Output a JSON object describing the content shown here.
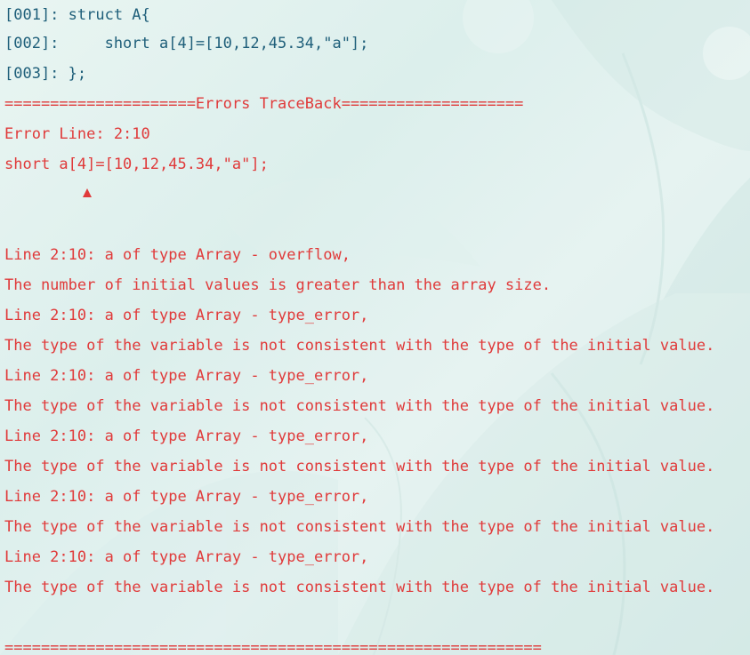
{
  "colors": {
    "code_text": "#1f5f7a",
    "error_text": "#e03a3a"
  },
  "source": {
    "lines": [
      "[001]: struct A{",
      "[002]:     short a[4]=[10,12,45.34,\"a\"];",
      "[003]: };"
    ]
  },
  "traceback": {
    "header": "=====================Errors TraceBack====================",
    "error_line_label": "Error Line: 2:10",
    "error_source": "short a[4]=[10,12,45.34,\"a\"];",
    "marker_icon": "caret-up-icon",
    "messages": [
      "Line 2:10: a of type Array - overflow,",
      "The number of initial values is greater than the array size.",
      "Line 2:10: a of type Array - type_error,",
      "The type of the variable is not consistent with the type of the initial value.",
      "Line 2:10: a of type Array - type_error,",
      "The type of the variable is not consistent with the type of the initial value.",
      "Line 2:10: a of type Array - type_error,",
      "The type of the variable is not consistent with the type of the initial value.",
      "Line 2:10: a of type Array - type_error,",
      "The type of the variable is not consistent with the type of the initial value.",
      "Line 2:10: a of type Array - type_error,",
      "The type of the variable is not consistent with the type of the initial value."
    ],
    "footer": "==========================================================="
  }
}
